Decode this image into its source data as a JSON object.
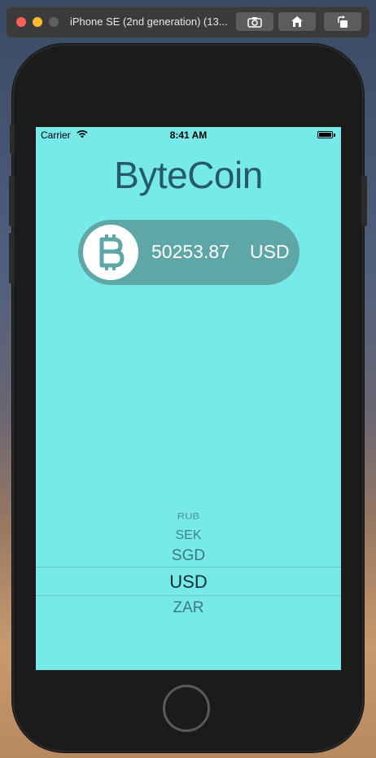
{
  "window": {
    "title": "iPhone SE (2nd generation) (13..."
  },
  "status_bar": {
    "carrier": "Carrier",
    "time": "8:41 AM"
  },
  "app": {
    "title": "ByteCoin",
    "rate_value": "50253.87",
    "rate_currency": "USD"
  },
  "picker": {
    "items": [
      "",
      "RUB",
      "SEK",
      "SGD",
      "USD",
      "ZAR"
    ],
    "selected": "USD"
  },
  "colors": {
    "screen_background": "#77e9e8",
    "title_text": "#255a69",
    "pill_background": "#5fa7a7",
    "bitcoin_icon": "#5fa7a7"
  }
}
